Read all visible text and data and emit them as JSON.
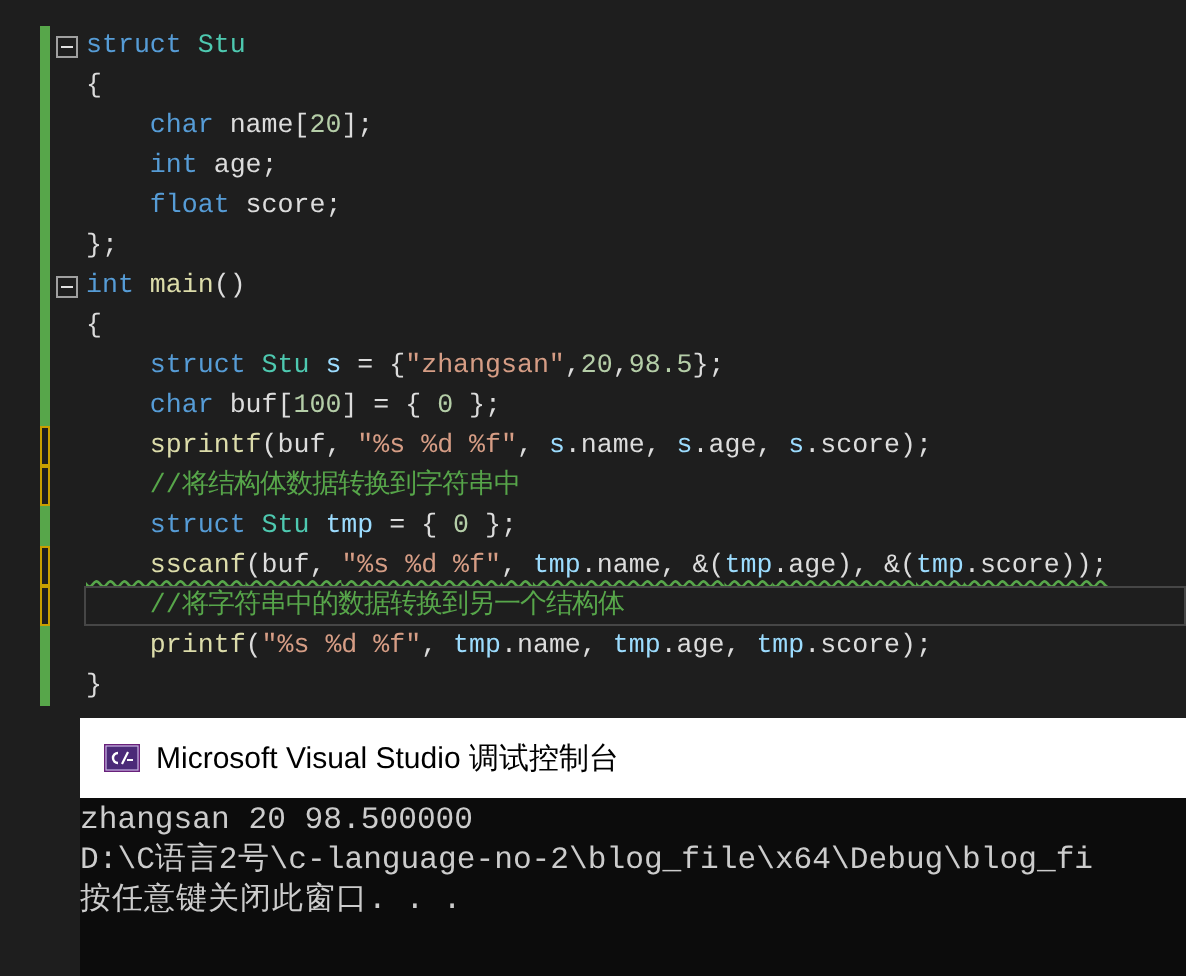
{
  "editor": {
    "lines": [
      {
        "fold": true,
        "unsaved": false,
        "current": false,
        "warning": false,
        "tokens": [
          {
            "kind": "kw",
            "text": "struct"
          },
          {
            "kind": "type",
            "text": " Stu"
          }
        ]
      },
      {
        "fold": false,
        "unsaved": false,
        "current": false,
        "warning": false,
        "tokens": [
          {
            "kind": "plain",
            "text": "{"
          }
        ]
      },
      {
        "fold": false,
        "unsaved": false,
        "current": false,
        "warning": false,
        "tokens": [
          {
            "kind": "kw",
            "text": "    char"
          },
          {
            "kind": "plain",
            "text": " name["
          },
          {
            "kind": "num",
            "text": "20"
          },
          {
            "kind": "plain",
            "text": "];"
          }
        ]
      },
      {
        "fold": false,
        "unsaved": false,
        "current": false,
        "warning": false,
        "tokens": [
          {
            "kind": "kw",
            "text": "    int"
          },
          {
            "kind": "plain",
            "text": " age;"
          }
        ]
      },
      {
        "fold": false,
        "unsaved": false,
        "current": false,
        "warning": false,
        "tokens": [
          {
            "kind": "kw",
            "text": "    float"
          },
          {
            "kind": "plain",
            "text": " score;"
          }
        ]
      },
      {
        "fold": false,
        "unsaved": false,
        "current": false,
        "warning": false,
        "tokens": [
          {
            "kind": "plain",
            "text": "};"
          }
        ]
      },
      {
        "fold": true,
        "unsaved": false,
        "current": false,
        "warning": false,
        "tokens": [
          {
            "kind": "kw",
            "text": "int"
          },
          {
            "kind": "func",
            "text": " main"
          },
          {
            "kind": "plain",
            "text": "()"
          }
        ]
      },
      {
        "fold": false,
        "unsaved": false,
        "current": false,
        "warning": false,
        "tokens": [
          {
            "kind": "plain",
            "text": "{"
          }
        ]
      },
      {
        "fold": false,
        "unsaved": false,
        "current": false,
        "warning": false,
        "tokens": [
          {
            "kind": "kw",
            "text": "    struct"
          },
          {
            "kind": "type",
            "text": " Stu"
          },
          {
            "kind": "var",
            "text": " s"
          },
          {
            "kind": "plain",
            "text": " = {"
          },
          {
            "kind": "str",
            "text": "\"zhangsan\""
          },
          {
            "kind": "plain",
            "text": ","
          },
          {
            "kind": "num",
            "text": "20"
          },
          {
            "kind": "plain",
            "text": ","
          },
          {
            "kind": "num",
            "text": "98.5"
          },
          {
            "kind": "plain",
            "text": "};"
          }
        ]
      },
      {
        "fold": false,
        "unsaved": false,
        "current": false,
        "warning": false,
        "tokens": [
          {
            "kind": "kw",
            "text": "    char"
          },
          {
            "kind": "plain",
            "text": " buf["
          },
          {
            "kind": "num",
            "text": "100"
          },
          {
            "kind": "plain",
            "text": "] = {"
          },
          {
            "kind": "num",
            "text": " 0"
          },
          {
            "kind": "plain",
            "text": " };"
          }
        ]
      },
      {
        "fold": false,
        "unsaved": true,
        "current": false,
        "warning": false,
        "tokens": [
          {
            "kind": "func",
            "text": "    sprintf"
          },
          {
            "kind": "plain",
            "text": "(buf, "
          },
          {
            "kind": "str",
            "text": "\"%s %d %f\""
          },
          {
            "kind": "plain",
            "text": ", "
          },
          {
            "kind": "var",
            "text": "s"
          },
          {
            "kind": "plain",
            "text": ".name, "
          },
          {
            "kind": "var",
            "text": "s"
          },
          {
            "kind": "plain",
            "text": ".age, "
          },
          {
            "kind": "var",
            "text": "s"
          },
          {
            "kind": "plain",
            "text": ".score);"
          }
        ]
      },
      {
        "fold": false,
        "unsaved": true,
        "current": false,
        "warning": false,
        "tokens": [
          {
            "kind": "comment",
            "text": "    //将结构体数据转换到字符串中"
          }
        ]
      },
      {
        "fold": false,
        "unsaved": false,
        "current": false,
        "warning": false,
        "tokens": [
          {
            "kind": "kw",
            "text": "    struct"
          },
          {
            "kind": "type",
            "text": " Stu"
          },
          {
            "kind": "var",
            "text": " tmp"
          },
          {
            "kind": "plain",
            "text": " = {"
          },
          {
            "kind": "num",
            "text": " 0"
          },
          {
            "kind": "plain",
            "text": " };"
          }
        ]
      },
      {
        "fold": false,
        "unsaved": true,
        "current": false,
        "warning": true,
        "tokens": [
          {
            "kind": "func",
            "text": "    sscanf"
          },
          {
            "kind": "plain",
            "text": "(buf, "
          },
          {
            "kind": "str",
            "text": "\"%s %d %f\""
          },
          {
            "kind": "plain",
            "text": ", "
          },
          {
            "kind": "var",
            "text": "tmp"
          },
          {
            "kind": "plain",
            "text": ".name, &("
          },
          {
            "kind": "var",
            "text": "tmp"
          },
          {
            "kind": "plain",
            "text": ".age), &("
          },
          {
            "kind": "var",
            "text": "tmp"
          },
          {
            "kind": "plain",
            "text": ".score));"
          }
        ]
      },
      {
        "fold": false,
        "unsaved": true,
        "current": true,
        "warning": false,
        "tokens": [
          {
            "kind": "comment",
            "text": "    //将字符串中的数据转换到另一个结构体"
          }
        ]
      },
      {
        "fold": false,
        "unsaved": false,
        "current": false,
        "warning": false,
        "tokens": [
          {
            "kind": "func",
            "text": "    printf"
          },
          {
            "kind": "plain",
            "text": "("
          },
          {
            "kind": "str",
            "text": "\"%s %d %f\""
          },
          {
            "kind": "plain",
            "text": ", "
          },
          {
            "kind": "var",
            "text": "tmp"
          },
          {
            "kind": "plain",
            "text": ".name, "
          },
          {
            "kind": "var",
            "text": "tmp"
          },
          {
            "kind": "plain",
            "text": ".age, "
          },
          {
            "kind": "var",
            "text": "tmp"
          },
          {
            "kind": "plain",
            "text": ".score);"
          }
        ]
      },
      {
        "fold": false,
        "unsaved": false,
        "current": false,
        "warning": false,
        "tokens": [
          {
            "kind": "plain",
            "text": "}"
          }
        ]
      }
    ]
  },
  "console": {
    "title": "Microsoft Visual Studio 调试控制台",
    "lines": [
      "zhangsan 20 98.500000",
      "D:\\C语言2号\\c-language-no-2\\blog_file\\x64\\Debug\\blog_fi",
      "按任意键关闭此窗口. . ."
    ]
  }
}
